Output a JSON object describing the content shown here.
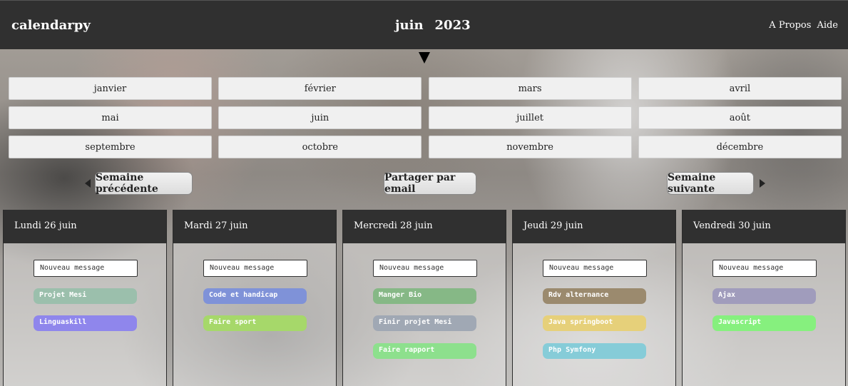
{
  "header": {
    "brand": "calendarpy",
    "month": "juin",
    "year": "2023",
    "links": [
      "A Propos",
      "Aide"
    ]
  },
  "months": [
    "janvier",
    "février",
    "mars",
    "avril",
    "mai",
    "juin",
    "juillet",
    "août",
    "septembre",
    "octobre",
    "novembre",
    "décembre"
  ],
  "week_nav": {
    "prev": "Semaine précédente",
    "share": "Partager par email",
    "next": "Semaine suivante"
  },
  "days": [
    {
      "title": "Lundi 26 juin",
      "new_message": "Nouveau message",
      "tasks": [
        {
          "label": "Projet Mesi",
          "color": "#9bbfac"
        },
        {
          "label": "Linguaskill",
          "color": "#8f86ec"
        }
      ]
    },
    {
      "title": "Mardi 27 juin",
      "new_message": "Nouveau message",
      "tasks": [
        {
          "label": "Code et handicap",
          "color": "#7f92d8"
        },
        {
          "label": "Faire sport",
          "color": "#a6d86a"
        }
      ]
    },
    {
      "title": "Mercredi 28 juin",
      "new_message": "Nouveau message",
      "tasks": [
        {
          "label": "Manger Bio",
          "color": "#86b886"
        },
        {
          "label": "Finir projet Mesi",
          "color": "#a0a8b4"
        },
        {
          "label": "Faire rapport",
          "color": "#8de08d"
        }
      ]
    },
    {
      "title": "Jeudi 29 juin",
      "new_message": "Nouveau message",
      "tasks": [
        {
          "label": "Rdv alternance",
          "color": "#9b8a6e"
        },
        {
          "label": "Java springboot",
          "color": "#e6d07a"
        },
        {
          "label": "Php Symfony",
          "color": "#86ccd8"
        }
      ]
    },
    {
      "title": "Vendredi 30 juin",
      "new_message": "Nouveau message",
      "tasks": [
        {
          "label": "Ajax",
          "color": "#a09cbc"
        },
        {
          "label": "Javascript",
          "color": "#86f07e"
        }
      ]
    }
  ]
}
